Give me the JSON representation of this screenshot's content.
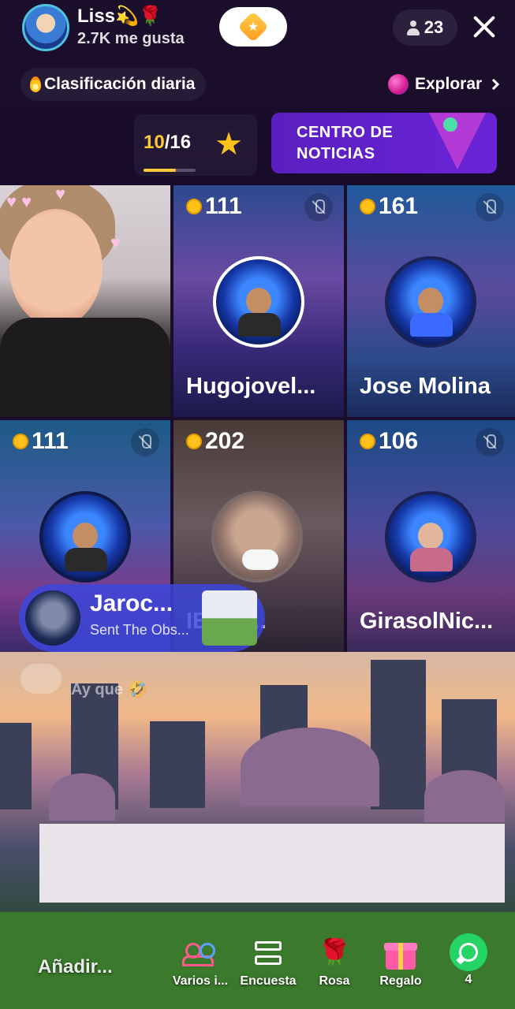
{
  "header": {
    "host_name": "Liss💫🌹",
    "host_likes": "2.7K me gusta",
    "viewer_count": "23",
    "ranking_label": "Clasificación diaria",
    "explore_label": "Explorar",
    "progress": {
      "current": "10",
      "total": "/16",
      "fraction": 0.625
    },
    "news_banner": "CENTRO DE NOTICIAS"
  },
  "guests": [
    {
      "slot": 2,
      "score": "111",
      "name": "Hugojovel...",
      "muted": true
    },
    {
      "slot": 3,
      "score": "161",
      "name": "Jose Molina",
      "muted": true
    },
    {
      "slot": 4,
      "score": "111",
      "name": "",
      "muted": true
    },
    {
      "slot": 5,
      "score": "202",
      "name": "IECHi...",
      "muted": false
    },
    {
      "slot": 6,
      "score": "106",
      "name": "GirasolNic...",
      "muted": true
    }
  ],
  "gift_notification": {
    "sender": "Jaroc...",
    "message": "Sent The Obs..."
  },
  "chat": {
    "ghost_message": "Ay que 🤣"
  },
  "bottom_bar": {
    "input_placeholder": "Añadir...",
    "actions": [
      {
        "label": "Varios i...",
        "icon": "multi-guest-icon"
      },
      {
        "label": "Encuesta",
        "icon": "poll-icon"
      },
      {
        "label": "Rosa",
        "icon": "rose-icon"
      },
      {
        "label": "Regalo",
        "icon": "gift-icon"
      },
      {
        "label": "4",
        "icon": "whatsapp-icon"
      }
    ]
  },
  "colors": {
    "accent_gold": "#ffc93a",
    "news_purple": "#5a1fc0",
    "gift_banner_blue": "#3c46dc",
    "whatsapp_green": "#25d366"
  }
}
